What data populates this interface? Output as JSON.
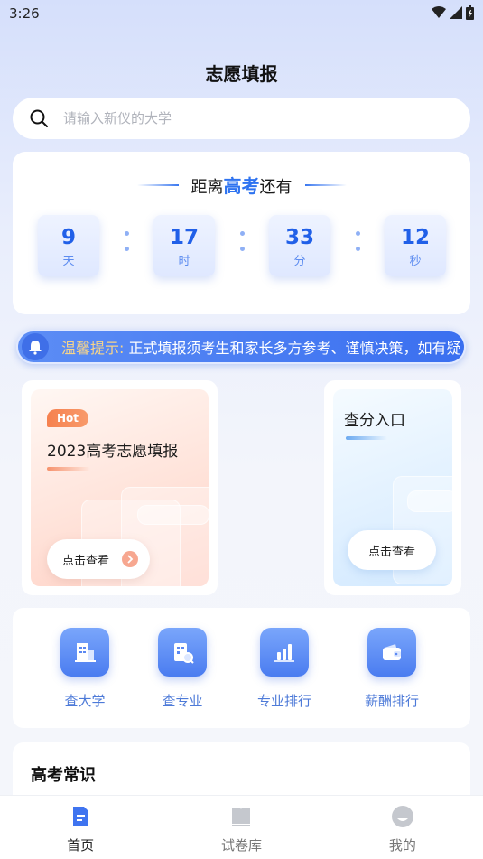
{
  "status_bar": {
    "time": "3:26"
  },
  "page_title": "志愿填报",
  "search": {
    "placeholder": "请输入新仪的大学"
  },
  "countdown": {
    "heading_prefix": "距离",
    "heading_highlight": "高考",
    "heading_suffix": "还有",
    "items": [
      {
        "value": "9",
        "unit": "天"
      },
      {
        "value": "17",
        "unit": "时"
      },
      {
        "value": "33",
        "unit": "分"
      },
      {
        "value": "12",
        "unit": "秒"
      }
    ]
  },
  "notice": {
    "label": "温馨提示:",
    "text": "正式填报须考生和家长多方参考、谨慎决策，如有疑"
  },
  "features": {
    "left": {
      "badge": "Hot",
      "title": "2023高考志愿填报",
      "button": "点击查看"
    },
    "right": {
      "title": "查分入口",
      "button": "点击查看"
    }
  },
  "quick_links": [
    {
      "label": "查大学",
      "icon": "university-building-icon"
    },
    {
      "label": "查专业",
      "icon": "major-search-icon"
    },
    {
      "label": "专业排行",
      "icon": "bar-chart-ranking-icon"
    },
    {
      "label": "薪酬排行",
      "icon": "wallet-icon"
    }
  ],
  "knowledge": {
    "title": "高考常识"
  },
  "tabbar": {
    "items": [
      {
        "label": "首页",
        "icon": "home-document-icon",
        "active": true
      },
      {
        "label": "试卷库",
        "icon": "book-icon",
        "active": false
      },
      {
        "label": "我的",
        "icon": "profile-icon",
        "active": false
      }
    ]
  },
  "colors": {
    "accent": "#2e73f0",
    "notice_label": "#f6d48a",
    "hot_badge": "#f6814f"
  }
}
